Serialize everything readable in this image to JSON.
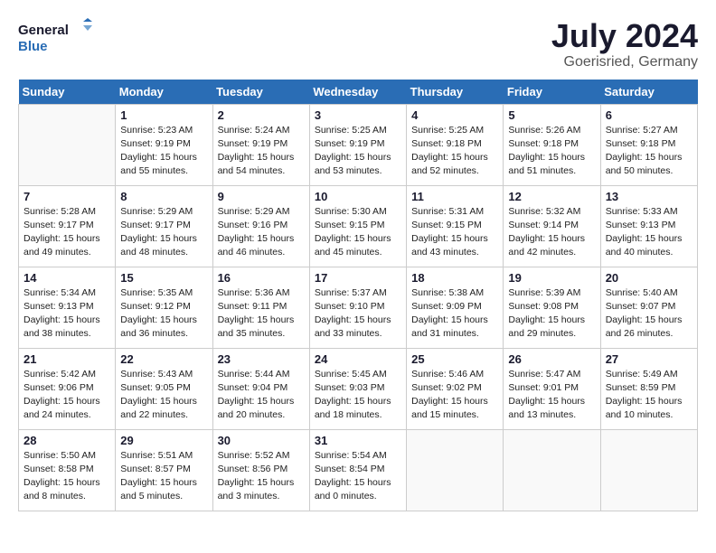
{
  "header": {
    "logo_line1": "General",
    "logo_line2": "Blue",
    "month_year": "July 2024",
    "location": "Goerisried, Germany"
  },
  "weekdays": [
    "Sunday",
    "Monday",
    "Tuesday",
    "Wednesday",
    "Thursday",
    "Friday",
    "Saturday"
  ],
  "weeks": [
    [
      {
        "day": "",
        "info": ""
      },
      {
        "day": "1",
        "info": "Sunrise: 5:23 AM\nSunset: 9:19 PM\nDaylight: 15 hours\nand 55 minutes."
      },
      {
        "day": "2",
        "info": "Sunrise: 5:24 AM\nSunset: 9:19 PM\nDaylight: 15 hours\nand 54 minutes."
      },
      {
        "day": "3",
        "info": "Sunrise: 5:25 AM\nSunset: 9:19 PM\nDaylight: 15 hours\nand 53 minutes."
      },
      {
        "day": "4",
        "info": "Sunrise: 5:25 AM\nSunset: 9:18 PM\nDaylight: 15 hours\nand 52 minutes."
      },
      {
        "day": "5",
        "info": "Sunrise: 5:26 AM\nSunset: 9:18 PM\nDaylight: 15 hours\nand 51 minutes."
      },
      {
        "day": "6",
        "info": "Sunrise: 5:27 AM\nSunset: 9:18 PM\nDaylight: 15 hours\nand 50 minutes."
      }
    ],
    [
      {
        "day": "7",
        "info": "Sunrise: 5:28 AM\nSunset: 9:17 PM\nDaylight: 15 hours\nand 49 minutes."
      },
      {
        "day": "8",
        "info": "Sunrise: 5:29 AM\nSunset: 9:17 PM\nDaylight: 15 hours\nand 48 minutes."
      },
      {
        "day": "9",
        "info": "Sunrise: 5:29 AM\nSunset: 9:16 PM\nDaylight: 15 hours\nand 46 minutes."
      },
      {
        "day": "10",
        "info": "Sunrise: 5:30 AM\nSunset: 9:15 PM\nDaylight: 15 hours\nand 45 minutes."
      },
      {
        "day": "11",
        "info": "Sunrise: 5:31 AM\nSunset: 9:15 PM\nDaylight: 15 hours\nand 43 minutes."
      },
      {
        "day": "12",
        "info": "Sunrise: 5:32 AM\nSunset: 9:14 PM\nDaylight: 15 hours\nand 42 minutes."
      },
      {
        "day": "13",
        "info": "Sunrise: 5:33 AM\nSunset: 9:13 PM\nDaylight: 15 hours\nand 40 minutes."
      }
    ],
    [
      {
        "day": "14",
        "info": "Sunrise: 5:34 AM\nSunset: 9:13 PM\nDaylight: 15 hours\nand 38 minutes."
      },
      {
        "day": "15",
        "info": "Sunrise: 5:35 AM\nSunset: 9:12 PM\nDaylight: 15 hours\nand 36 minutes."
      },
      {
        "day": "16",
        "info": "Sunrise: 5:36 AM\nSunset: 9:11 PM\nDaylight: 15 hours\nand 35 minutes."
      },
      {
        "day": "17",
        "info": "Sunrise: 5:37 AM\nSunset: 9:10 PM\nDaylight: 15 hours\nand 33 minutes."
      },
      {
        "day": "18",
        "info": "Sunrise: 5:38 AM\nSunset: 9:09 PM\nDaylight: 15 hours\nand 31 minutes."
      },
      {
        "day": "19",
        "info": "Sunrise: 5:39 AM\nSunset: 9:08 PM\nDaylight: 15 hours\nand 29 minutes."
      },
      {
        "day": "20",
        "info": "Sunrise: 5:40 AM\nSunset: 9:07 PM\nDaylight: 15 hours\nand 26 minutes."
      }
    ],
    [
      {
        "day": "21",
        "info": "Sunrise: 5:42 AM\nSunset: 9:06 PM\nDaylight: 15 hours\nand 24 minutes."
      },
      {
        "day": "22",
        "info": "Sunrise: 5:43 AM\nSunset: 9:05 PM\nDaylight: 15 hours\nand 22 minutes."
      },
      {
        "day": "23",
        "info": "Sunrise: 5:44 AM\nSunset: 9:04 PM\nDaylight: 15 hours\nand 20 minutes."
      },
      {
        "day": "24",
        "info": "Sunrise: 5:45 AM\nSunset: 9:03 PM\nDaylight: 15 hours\nand 18 minutes."
      },
      {
        "day": "25",
        "info": "Sunrise: 5:46 AM\nSunset: 9:02 PM\nDaylight: 15 hours\nand 15 minutes."
      },
      {
        "day": "26",
        "info": "Sunrise: 5:47 AM\nSunset: 9:01 PM\nDaylight: 15 hours\nand 13 minutes."
      },
      {
        "day": "27",
        "info": "Sunrise: 5:49 AM\nSunset: 8:59 PM\nDaylight: 15 hours\nand 10 minutes."
      }
    ],
    [
      {
        "day": "28",
        "info": "Sunrise: 5:50 AM\nSunset: 8:58 PM\nDaylight: 15 hours\nand 8 minutes."
      },
      {
        "day": "29",
        "info": "Sunrise: 5:51 AM\nSunset: 8:57 PM\nDaylight: 15 hours\nand 5 minutes."
      },
      {
        "day": "30",
        "info": "Sunrise: 5:52 AM\nSunset: 8:56 PM\nDaylight: 15 hours\nand 3 minutes."
      },
      {
        "day": "31",
        "info": "Sunrise: 5:54 AM\nSunset: 8:54 PM\nDaylight: 15 hours\nand 0 minutes."
      },
      {
        "day": "",
        "info": ""
      },
      {
        "day": "",
        "info": ""
      },
      {
        "day": "",
        "info": ""
      }
    ]
  ]
}
